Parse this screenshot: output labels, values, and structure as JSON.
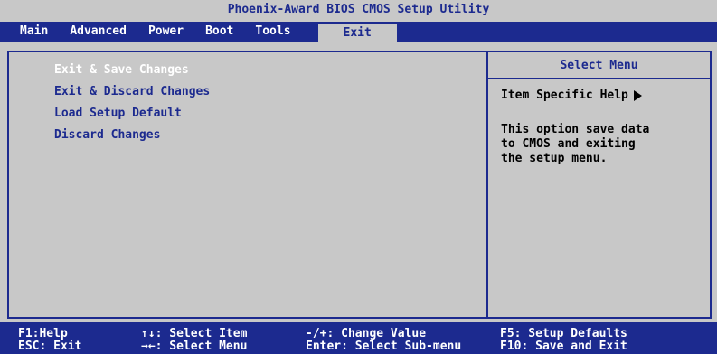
{
  "title": "Phoenix-Award BIOS CMOS Setup Utility",
  "menu": {
    "items": [
      {
        "label": "Main"
      },
      {
        "label": "Advanced"
      },
      {
        "label": "Power"
      },
      {
        "label": "Boot"
      },
      {
        "label": "Tools"
      },
      {
        "label": "Exit"
      }
    ],
    "active": "Exit"
  },
  "options": [
    {
      "label": "Exit & Save Changes",
      "selected": true
    },
    {
      "label": "Exit & Discard Changes",
      "selected": false
    },
    {
      "label": "Load Setup Default",
      "selected": false
    },
    {
      "label": "Discard Changes",
      "selected": false
    }
  ],
  "help": {
    "header": "Select Menu",
    "title": "Item Specific Help",
    "title_icon": "right-triangle-arrow",
    "text": "This option save data\nto CMOS and exiting\nthe setup menu."
  },
  "footer": {
    "col1": [
      "F1:Help",
      "ESC: Exit"
    ],
    "col2": [
      "↑↓: Select Item",
      "→←: Select Menu"
    ],
    "col3": [
      "-/+: Change Value",
      "Enter: Select Sub-menu"
    ],
    "col4": [
      "F5: Setup Defaults",
      "F10: Save and Exit"
    ]
  },
  "colors": {
    "background": "#c8c8c8",
    "accent": "#1c2a8f",
    "selected_text": "#ffffff",
    "help_text": "#000000"
  }
}
